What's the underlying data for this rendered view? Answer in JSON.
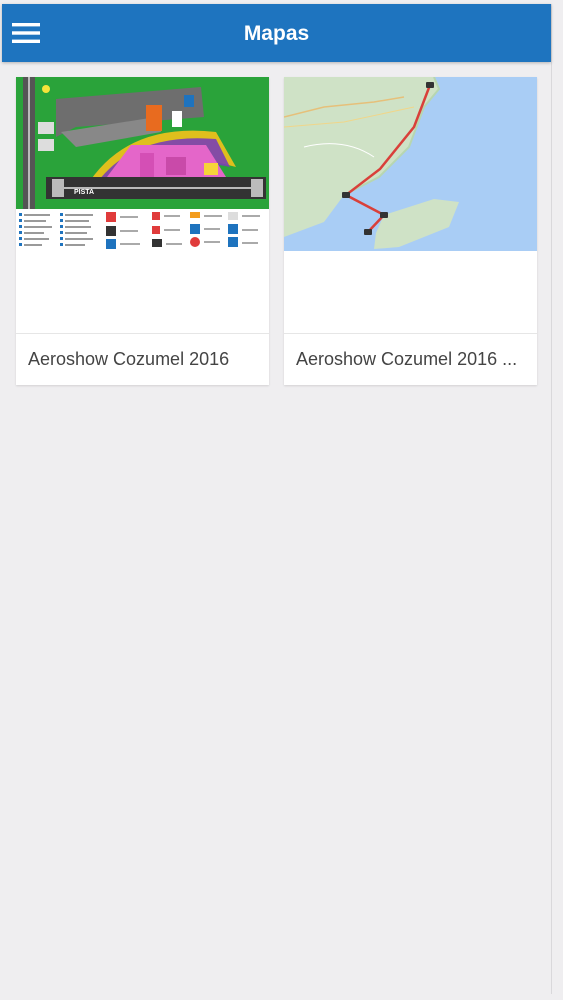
{
  "header": {
    "title": "Mapas",
    "menu_icon": "hamburger-menu-icon",
    "color": "#1e74bf"
  },
  "maps": [
    {
      "label": "Aeroshow Cozumel 2016",
      "map_text": "PISTA"
    },
    {
      "label": "Aeroshow Cozumel 2016 ..."
    }
  ]
}
